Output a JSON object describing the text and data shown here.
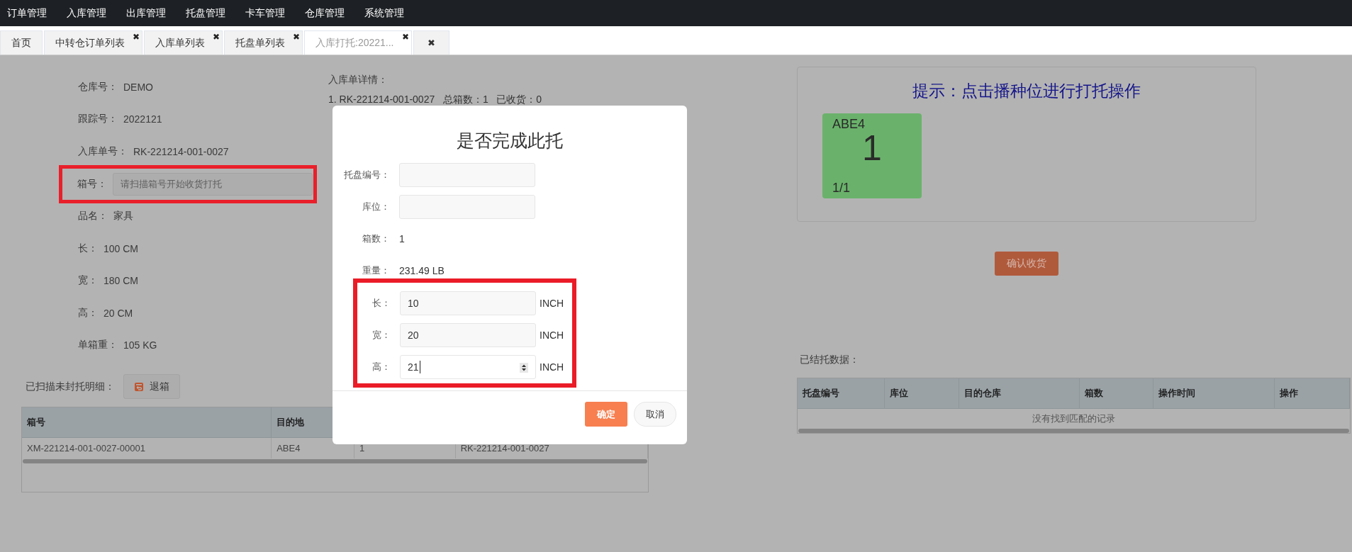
{
  "nav": {
    "items": [
      "订单管理",
      "入库管理",
      "出库管理",
      "托盘管理",
      "卡车管理",
      "仓库管理",
      "系统管理"
    ]
  },
  "tabs": [
    {
      "label": "首页",
      "selected": false
    },
    {
      "label": "中转仓订单列表",
      "selected": false,
      "close": "✖"
    },
    {
      "label": "入库单列表",
      "selected": false,
      "close": "✖"
    },
    {
      "label": "托盘单列表",
      "selected": false,
      "close": "✖"
    },
    {
      "label": "入库打托:20221...",
      "selected": true,
      "close": "✖"
    }
  ],
  "close_all": "✖",
  "info": [
    {
      "kind": "text",
      "label": "仓库号：",
      "value": "DEMO"
    },
    {
      "kind": "text",
      "label": "跟踪号：",
      "value": "2022121"
    },
    {
      "kind": "text",
      "label": "入库单号：",
      "value": "RK-221214-001-0027"
    },
    {
      "kind": "input",
      "label": "箱号：",
      "placeholder": "请扫描箱号开始收货打托",
      "highlighted": true
    },
    {
      "kind": "text",
      "label": "品名：",
      "value": "家具"
    },
    {
      "kind": "text",
      "label": "长：",
      "value": "100 CM"
    },
    {
      "kind": "text",
      "label": "宽：",
      "value": "180 CM"
    },
    {
      "kind": "text",
      "label": "高：",
      "value": "20 CM"
    },
    {
      "kind": "text",
      "label": "单箱重：",
      "value": "105 KG"
    }
  ],
  "details": {
    "title": "入库单详情：",
    "line": "1. RK-221214-001-0027   总箱数：1   已收货：0"
  },
  "scanned": {
    "title": "已扫描未封托明细：",
    "return_button": "退箱",
    "columns": [
      "箱号",
      "目的地"
    ],
    "rows": [
      [
        "XM-221214-001-0027-00001",
        "ABE4",
        "1",
        "RK-221214-001-0027"
      ]
    ]
  },
  "hint_panel": {
    "title": "提示：点击播种位进行打托操作",
    "slots": [
      {
        "code": "ABE4",
        "count": "1",
        "progress": "1/1"
      }
    ]
  },
  "confirm_button": "确认收货",
  "pallets": {
    "title": "已结托数据：",
    "columns": [
      "托盘编号",
      "库位",
      "目的仓库",
      "箱数",
      "操作时间",
      "操作"
    ],
    "empty_text": "没有找到匹配的记录"
  },
  "modal": {
    "title": "是否完成此托",
    "fields": [
      {
        "kind": "input",
        "label": "托盘编号："
      },
      {
        "kind": "input",
        "label": "库位："
      },
      {
        "kind": "text",
        "label": "箱数：",
        "value": "1"
      },
      {
        "kind": "text",
        "label": "重量：",
        "value": "231.49 LB"
      }
    ],
    "marked_fields": [
      {
        "kind": "input",
        "label": "长：",
        "value": "10",
        "unit": "INCH",
        "focused": false
      },
      {
        "kind": "input",
        "label": "宽：",
        "value": "20",
        "unit": "INCH",
        "focused": false
      },
      {
        "kind": "number",
        "label": "高：",
        "value": "21",
        "unit": "INCH",
        "focused": true
      }
    ],
    "ok_button": "确定",
    "cancel_button": "取消"
  }
}
